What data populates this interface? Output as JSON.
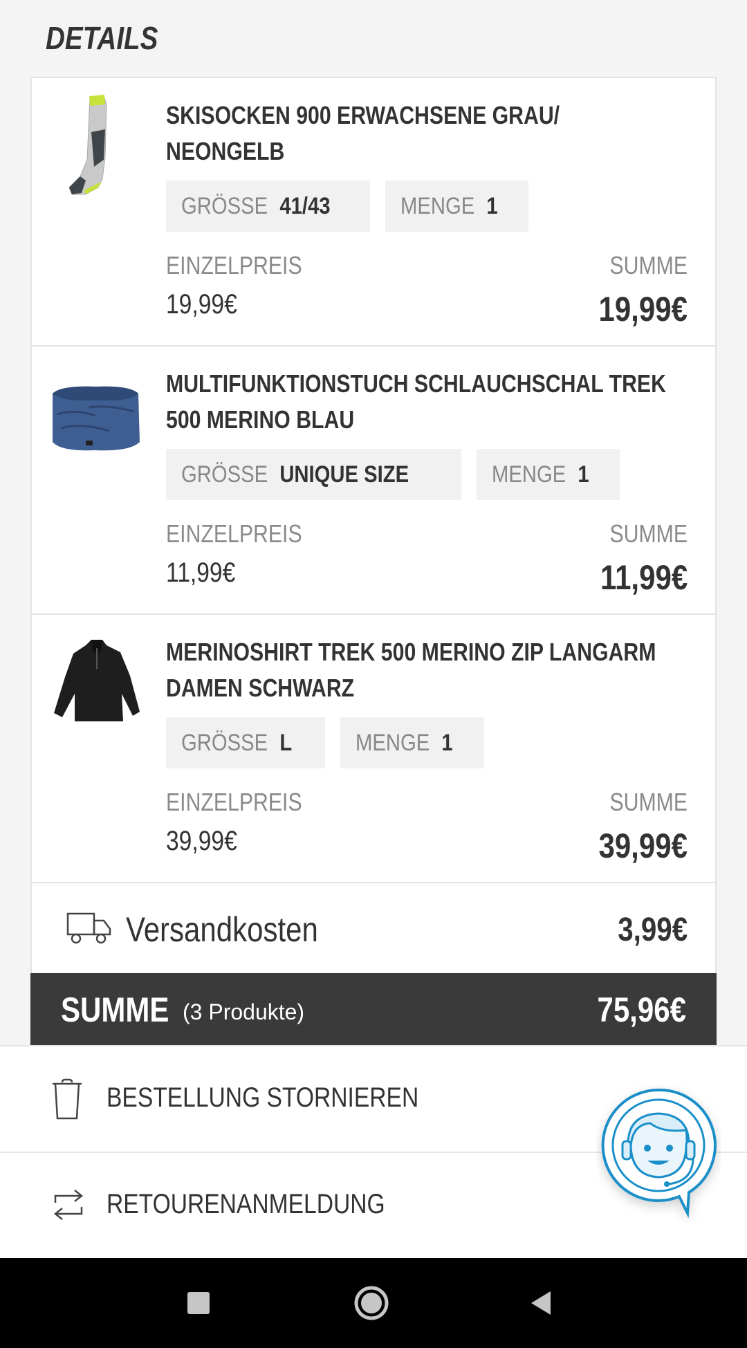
{
  "header": {
    "title": "DETAILS"
  },
  "items": [
    {
      "name": "SKISOCKEN 900 ERWACHSENE GRAU/ NEONGELB",
      "size_label": "GRÖSSE",
      "size_value": "41/43",
      "qty_label": "MENGE",
      "qty_value": "1",
      "unit_price_label": "EINZELPREIS",
      "unit_price": "19,99€",
      "sum_label": "SUMME",
      "sum": "19,99€",
      "image": "ski-socks-image"
    },
    {
      "name": "MULTIFUNKTIONSTUCH SCHLAUCHSCHAL TREK 500 MERINO BLAU",
      "size_label": "GRÖSSE",
      "size_value": "UNIQUE SIZE",
      "qty_label": "MENGE",
      "qty_value": "1",
      "unit_price_label": "EINZELPREIS",
      "unit_price": "11,99€",
      "sum_label": "SUMME",
      "sum": "11,99€",
      "image": "neck-gaiter-image"
    },
    {
      "name": "MERINOSHIRT TREK 500 MERINO ZIP LANGARM DAMEN SCHWARZ",
      "size_label": "GRÖSSE",
      "size_value": "L",
      "qty_label": "MENGE",
      "qty_value": "1",
      "unit_price_label": "EINZELPREIS",
      "unit_price": "39,99€",
      "sum_label": "SUMME",
      "sum": "39,99€",
      "image": "merino-shirt-image"
    }
  ],
  "shipping": {
    "label": "Versandkosten",
    "value": "3,99€",
    "icon": "truck-icon"
  },
  "total": {
    "label": "SUMME",
    "count": "(3 Produkte)",
    "value": "75,96€"
  },
  "actions": [
    {
      "label": "BESTELLUNG STORNIEREN",
      "icon": "trash-icon"
    },
    {
      "label": "RETOURENANMELDUNG",
      "icon": "return-icon"
    }
  ],
  "support": {
    "icon": "support-agent-icon"
  },
  "colors": {
    "total_bar": "#3a3a3a",
    "support_blue": "#1a8fc9",
    "chip_bg": "#f1f1f1"
  }
}
